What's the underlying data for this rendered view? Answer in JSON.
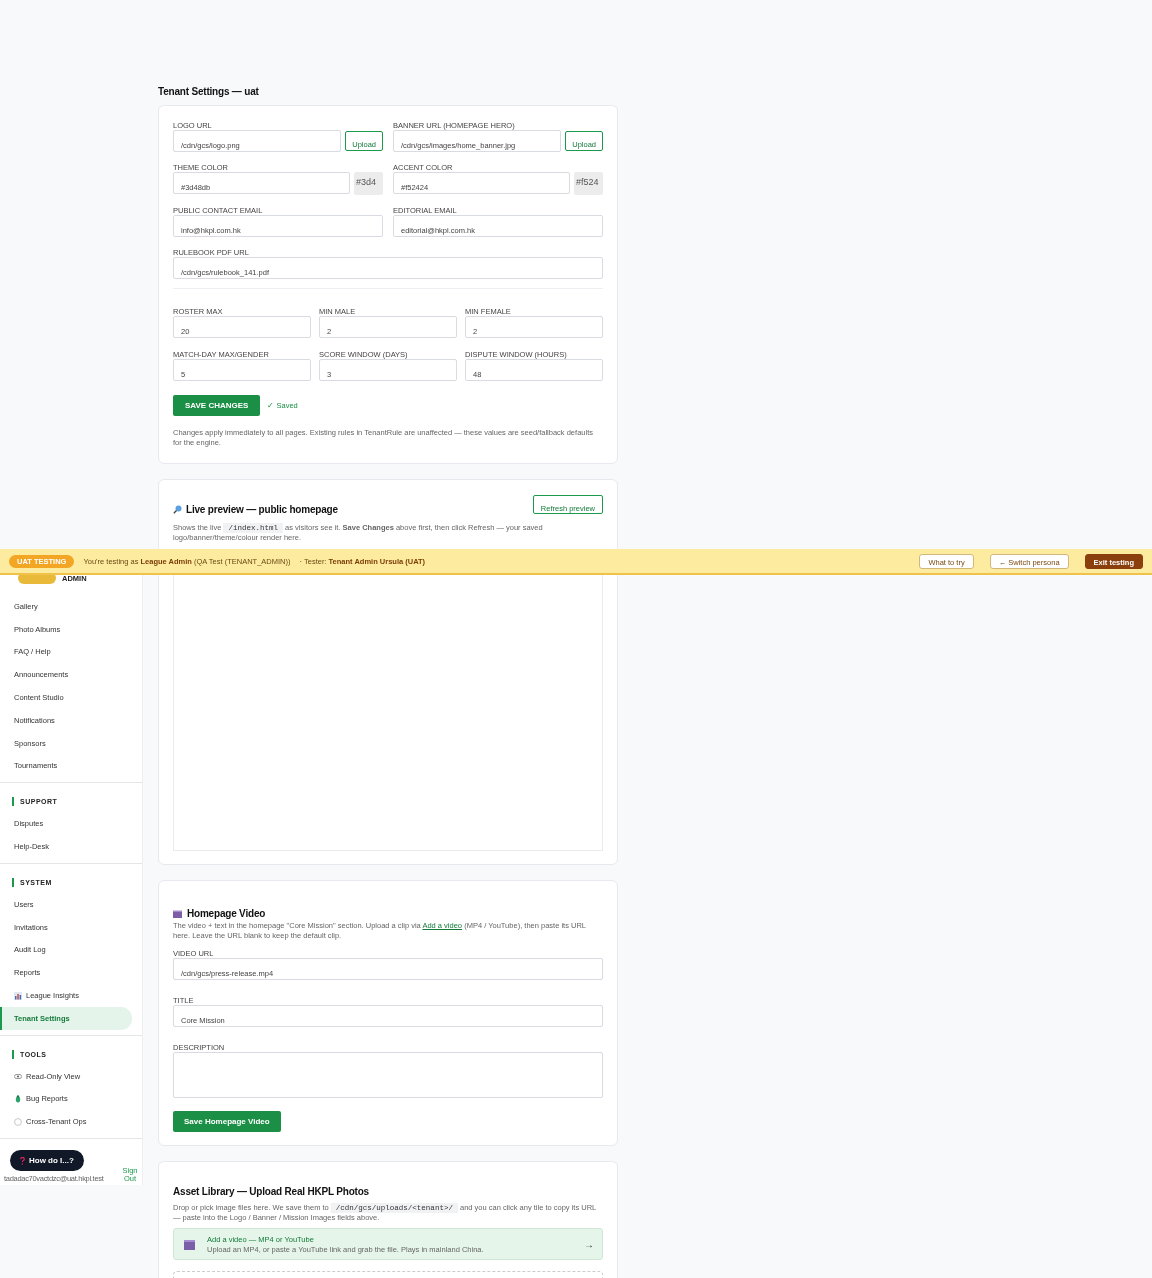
{
  "page_title": "Tenant Settings — uat",
  "settings": {
    "fields": [
      {
        "label": "LOGO URL",
        "value": "/cdn/gcs/logo.png",
        "kind": "upload",
        "button": "Upload"
      },
      {
        "label": "BANNER URL (HOMEPAGE HERO)",
        "value": "/cdn/gcs/images/home_banner.jpg",
        "kind": "upload",
        "button": "Upload"
      },
      {
        "label": "THEME COLOR",
        "value": "#3d48db",
        "kind": "color",
        "swatch": "#3d4"
      },
      {
        "label": "ACCENT COLOR",
        "value": "#f52424",
        "kind": "color",
        "swatch": "#f524"
      },
      {
        "label": "PUBLIC CONTACT EMAIL",
        "value": "info@hkpl.com.hk",
        "kind": "text"
      },
      {
        "label": "EDITORIAL EMAIL",
        "value": "editorial@hkpl.com.hk",
        "kind": "text"
      },
      {
        "label": "RULEBOOK PDF URL",
        "value": "/cdn/gcs/rulebook_141.pdf",
        "kind": "wide"
      }
    ],
    "numbers": [
      {
        "label": "ROSTER MAX",
        "value": "20"
      },
      {
        "label": "MIN MALE",
        "value": "2"
      },
      {
        "label": "MIN FEMALE",
        "value": "2"
      },
      {
        "label": "MATCH-DAY MAX/GENDER",
        "value": "5"
      },
      {
        "label": "SCORE WINDOW (DAYS)",
        "value": "3"
      },
      {
        "label": "DISPUTE WINDOW (HOURS)",
        "value": "48"
      }
    ],
    "save_button": "SAVE CHANGES",
    "saved_status": "✓ Saved",
    "note": "Changes apply immediately to all pages. Existing rules in TenantRule are unaffected — these values are seed/fallback defaults for the engine."
  },
  "preview": {
    "title": "Live preview — public homepage",
    "refresh_button": "Refresh preview",
    "description_before": "Shows the live",
    "code": "/index.html",
    "description_after": "as visitors see it. **Save Changes** above first, then click Refresh — your saved logo/banner/theme/colour render here."
  },
  "video": {
    "title": "Homepage Video",
    "description_before": "The video + text in the homepage \"Core Mission\" section. Upload a clip via",
    "link": "Add a video",
    "description_after": "(MP4 / YouTube), then paste its URL here. Leave the URL blank to keep the default clip.",
    "fields": [
      {
        "label": "VIDEO URL",
        "value": "/cdn/gcs/press-release.mp4",
        "kind": "text"
      },
      {
        "label": "TITLE",
        "value": "Core Mission",
        "kind": "text"
      },
      {
        "label": "DESCRIPTION",
        "kind": "textarea"
      }
    ],
    "save_button": "Save Homepage Video"
  },
  "assets": {
    "title": "Asset Library — Upload Real HKPL Photos",
    "description_before": "Drop or pick image files here. We save them to",
    "code": "/cdn/gcs/uploads/<tenant>/",
    "description_after": "and you can click any tile to copy its URL — paste into the Logo / Banner / Mission Images fields above.",
    "video_card": {
      "title": "Add a video — MP4 or YouTube",
      "subtitle": "Upload an MP4, or paste a YouTube link and grab the file. Plays in mainland China.",
      "arrow": "→"
    }
  },
  "banner": {
    "badge": "UAT TESTING",
    "text": "You're testing as **League Admin** (QA Test (TENANT_ADMIN))",
    "tester": "· Tester: **Tenant Admin Ursula (UAT)**",
    "buttons": [
      {
        "label": "What to try",
        "kind": "outline"
      },
      {
        "label": "← Switch persona",
        "kind": "outline"
      },
      {
        "label": "Exit testing",
        "kind": "primary"
      }
    ]
  },
  "sidebar": {
    "brand": "ADMIN",
    "groups": [
      {
        "items": [
          {
            "label": "Gallery",
            "kind": "plain",
            "selected": false
          },
          {
            "label": "Photo Albums",
            "kind": "plain",
            "selected": false
          },
          {
            "label": "FAQ / Help",
            "kind": "plain",
            "selected": false
          },
          {
            "label": "Announcements",
            "kind": "plain",
            "selected": false
          },
          {
            "label": "Content Studio",
            "kind": "plain",
            "selected": false
          },
          {
            "label": "Notifications",
            "kind": "plain",
            "selected": false
          },
          {
            "label": "Sponsors",
            "kind": "plain",
            "selected": false
          },
          {
            "label": "Tournaments",
            "kind": "plain",
            "selected": false
          }
        ]
      },
      {
        "title": "SUPPORT",
        "items": [
          {
            "label": "Disputes",
            "kind": "plain",
            "selected": false
          },
          {
            "label": "Help-Desk",
            "kind": "plain",
            "selected": false
          }
        ]
      },
      {
        "title": "SYSTEM",
        "items": [
          {
            "label": "Users",
            "kind": "plain",
            "selected": false
          },
          {
            "label": "Invitations",
            "kind": "plain",
            "selected": false
          },
          {
            "label": "Audit Log",
            "kind": "plain",
            "selected": false
          },
          {
            "label": "Reports",
            "kind": "plain",
            "selected": false
          },
          {
            "label": "League Insights",
            "kind": "chart",
            "selected": false
          },
          {
            "label": "Tenant Settings",
            "kind": "plain",
            "selected": true
          }
        ]
      },
      {
        "title": "TOOLS",
        "items": [
          {
            "label": "Read-Only View",
            "kind": "eye",
            "selected": false
          },
          {
            "label": "Bug Reports",
            "kind": "bug",
            "selected": false
          },
          {
            "label": "Cross-Tenant Ops",
            "kind": "globe",
            "selected": false
          }
        ]
      }
    ],
    "help_button": "How do I...?",
    "email": "tadadac70vactdzc@uat.hkpl.test",
    "sign_out": "Sign Out"
  }
}
